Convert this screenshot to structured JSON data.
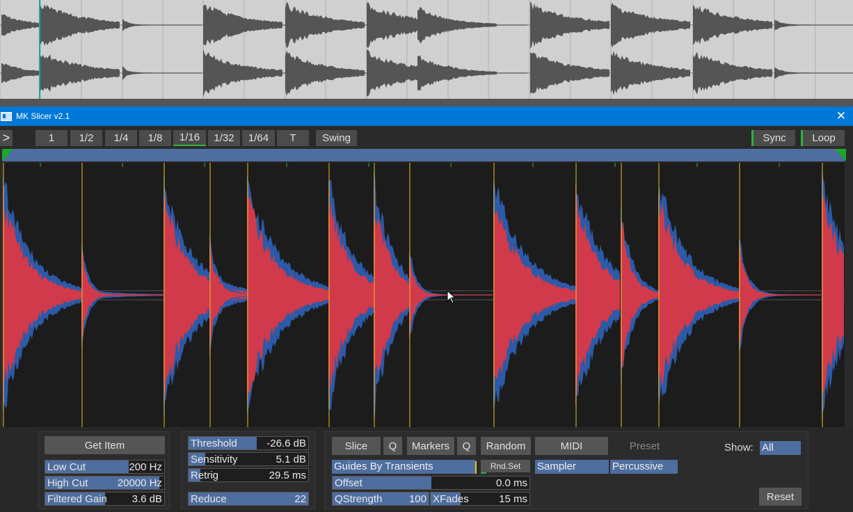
{
  "window": {
    "title": "MK Slicer v2.1",
    "close_glyph": "✕"
  },
  "toolbar": {
    "play_label": ">",
    "grid": [
      "1",
      "1/2",
      "1/4",
      "1/8",
      "1/16",
      "1/32",
      "1/64"
    ],
    "grid_active": "1/16",
    "t_label": "T",
    "swing_label": "Swing",
    "sync_label": "Sync",
    "loop_label": "Loop"
  },
  "colors": {
    "accent": "#4f6ea0",
    "waveform_red": "#d03a4a",
    "waveform_blue": "#2b5aa8",
    "marker": "#e8c020",
    "active_green": "#2fb43a"
  },
  "left_panel": {
    "get_item_label": "Get Item",
    "low_cut": {
      "label": "Low Cut",
      "value": "200 Hz",
      "fill": 0.7
    },
    "high_cut": {
      "label": "High Cut",
      "value": "20000 Hz",
      "fill": 0.96
    },
    "filtered_gain": {
      "label": "Filtered Gain",
      "value": "3.6 dB",
      "fill": 0.5
    }
  },
  "mid_panel": {
    "threshold": {
      "label": "Threshold",
      "value": "-26.6 dB",
      "fill": 0.57
    },
    "sensitivity": {
      "label": "Sensitivity",
      "value": "5.1 dB",
      "fill": 0.14
    },
    "retrig": {
      "label": "Retrig",
      "value": "29.5 ms",
      "fill": 0.1
    },
    "reduce": {
      "label": "Reduce",
      "value": "22",
      "fill": 1.0
    }
  },
  "right_panel": {
    "slice_label": "Slice",
    "q1_label": "Q",
    "markers_label": "Markers",
    "q2_label": "Q",
    "random_label": "Random",
    "midi_label": "MIDI",
    "preset_label": "Preset",
    "show_label": "Show:",
    "show_value": "All",
    "guides_label": "Guides By Transients",
    "rndset_label": "Rnd.Set",
    "sampler_label": "Sampler",
    "percussive_label": "Percussive",
    "offset": {
      "label": "Offset",
      "value": "0.0 ms",
      "fill": 0.5
    },
    "qstrength": {
      "label": "QStrength",
      "value": "100",
      "fill": 1.0
    },
    "xfades": {
      "label": "XFades",
      "value": "15 ms",
      "fill": 0.3
    },
    "reset_label": "Reset"
  }
}
